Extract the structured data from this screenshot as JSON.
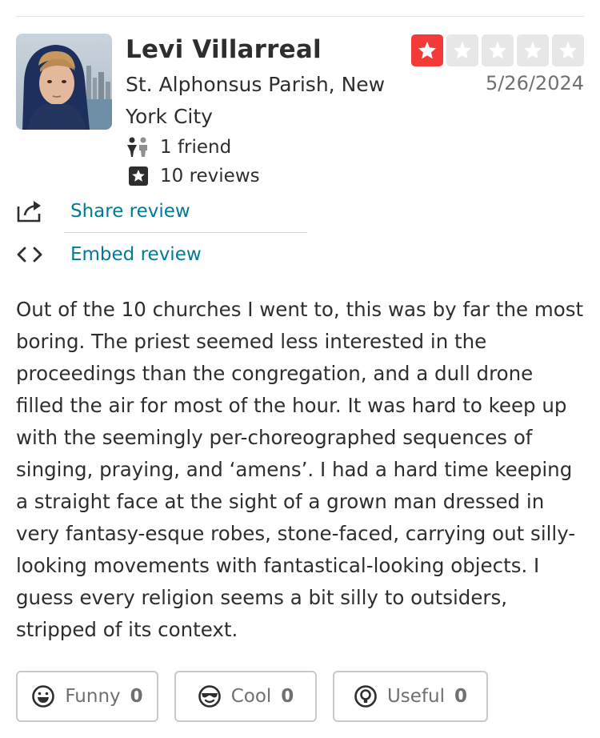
{
  "user": {
    "name": "Levi Villarreal",
    "location": "St. Alphonsus Parish, New York City",
    "friends": "1 friend",
    "reviews": "10 reviews"
  },
  "rating": {
    "value": 1,
    "max": 5,
    "filled_color": "#f43939",
    "empty_color": "#e7e7e7"
  },
  "date": "5/26/2024",
  "actions": {
    "share_label": "Share review",
    "embed_label": "Embed review"
  },
  "review_text": "Out of the 10 churches I went to, this was by far the most boring. The priest seemed less interested in the proceedings than the congregation, and a dull drone filled the air for most of the hour. It was hard to keep up with the seemingly per-choreographed sequences of singing, praying, and ‘amens’. I had a hard time keeping a straight face at the sight of a grown man dressed in very fantasy-esque robes, stone-faced, carrying out silly-looking movements with fantastical-looking objects. I guess every religion seems a bit silly to outsiders, stripped of its context.",
  "votes": {
    "funny": {
      "label": "Funny",
      "count": "0",
      "icon": "funny-face-icon"
    },
    "cool": {
      "label": "Cool",
      "count": "0",
      "icon": "sunglasses-face-icon"
    },
    "useful": {
      "label": "Useful",
      "count": "0",
      "icon": "lightbulb-icon"
    }
  },
  "colors": {
    "link": "#027a97",
    "text": "#2d2e2f",
    "muted": "#6e7072"
  }
}
